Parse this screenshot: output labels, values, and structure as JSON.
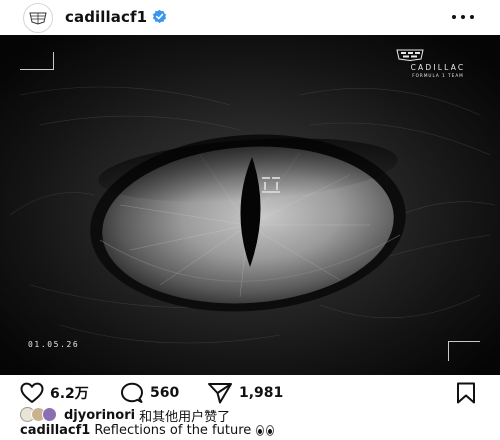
{
  "header": {
    "username": "cadillacf1",
    "avatar_icon": "cadillac-crest-icon",
    "verified_icon": "verified-badge-icon",
    "more_icon": "more-options-icon",
    "verified_color": "#3897f0"
  },
  "photo": {
    "brand_name": "CADILLAC",
    "brand_sub": "FORMULA 1 TEAM",
    "date_text": "01.05.26"
  },
  "actions": {
    "like_icon": "heart-icon",
    "like_count": "6.2万",
    "comment_icon": "comment-icon",
    "comment_count": "560",
    "share_icon": "send-icon",
    "share_count": "1,981",
    "save_icon": "bookmark-icon"
  },
  "likes": {
    "liker_username": "djyorinori",
    "suffix": "和其他用户赞了"
  },
  "caption": {
    "username": "cadillacf1",
    "text": "Reflections of the future",
    "emoji_icon": "eyes-emoji-icon"
  }
}
